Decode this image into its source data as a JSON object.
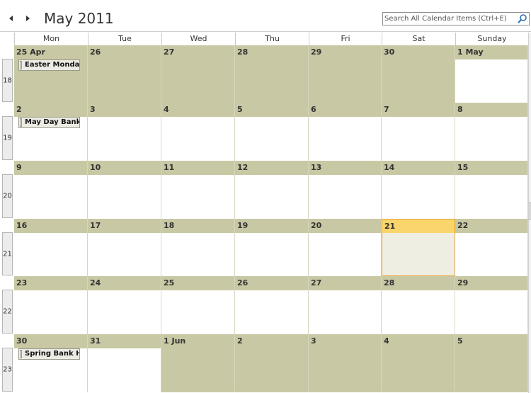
{
  "header": {
    "title": "May 2011",
    "search_placeholder": "Search All Calendar Items (Ctrl+E)"
  },
  "colors": {
    "out_of_month": "#c8c8a4",
    "today_header": "#f9d56b",
    "today_body": "#efeee3",
    "today_border": "#e6a740"
  },
  "icons": [
    "back-arrow-icon",
    "forward-arrow-icon",
    "search-icon"
  ],
  "day_headers": [
    "Mon",
    "Tue",
    "Wed",
    "Thu",
    "Fri",
    "Sat",
    "Sunday"
  ],
  "weeks": [
    {
      "number": "18",
      "days": [
        {
          "label": "25 Apr",
          "out": true,
          "event": "Easter Monday"
        },
        {
          "label": "26",
          "out": true
        },
        {
          "label": "27",
          "out": true
        },
        {
          "label": "28",
          "out": true
        },
        {
          "label": "29",
          "out": true
        },
        {
          "label": "30",
          "out": true
        },
        {
          "label": "1 May",
          "out": false
        }
      ]
    },
    {
      "number": "19",
      "days": [
        {
          "label": "2",
          "out": false,
          "event": "May Day Bank"
        },
        {
          "label": "3",
          "out": false
        },
        {
          "label": "4",
          "out": false
        },
        {
          "label": "5",
          "out": false
        },
        {
          "label": "6",
          "out": false
        },
        {
          "label": "7",
          "out": false
        },
        {
          "label": "8",
          "out": false
        }
      ]
    },
    {
      "number": "20",
      "days": [
        {
          "label": "9",
          "out": false
        },
        {
          "label": "10",
          "out": false
        },
        {
          "label": "11",
          "out": false
        },
        {
          "label": "12",
          "out": false
        },
        {
          "label": "13",
          "out": false
        },
        {
          "label": "14",
          "out": false
        },
        {
          "label": "15",
          "out": false
        }
      ]
    },
    {
      "number": "21",
      "days": [
        {
          "label": "16",
          "out": false
        },
        {
          "label": "17",
          "out": false
        },
        {
          "label": "18",
          "out": false
        },
        {
          "label": "19",
          "out": false
        },
        {
          "label": "20",
          "out": false
        },
        {
          "label": "21",
          "out": false,
          "today": true
        },
        {
          "label": "22",
          "out": false
        }
      ]
    },
    {
      "number": "22",
      "days": [
        {
          "label": "23",
          "out": false
        },
        {
          "label": "24",
          "out": false
        },
        {
          "label": "25",
          "out": false
        },
        {
          "label": "26",
          "out": false
        },
        {
          "label": "27",
          "out": false
        },
        {
          "label": "28",
          "out": false
        },
        {
          "label": "29",
          "out": false
        }
      ]
    },
    {
      "number": "23",
      "days": [
        {
          "label": "30",
          "out": false,
          "event": "Spring Bank Ho"
        },
        {
          "label": "31",
          "out": false
        },
        {
          "label": "1 Jun",
          "out": true
        },
        {
          "label": "2",
          "out": true
        },
        {
          "label": "3",
          "out": true
        },
        {
          "label": "4",
          "out": true
        },
        {
          "label": "5",
          "out": true
        }
      ]
    }
  ]
}
